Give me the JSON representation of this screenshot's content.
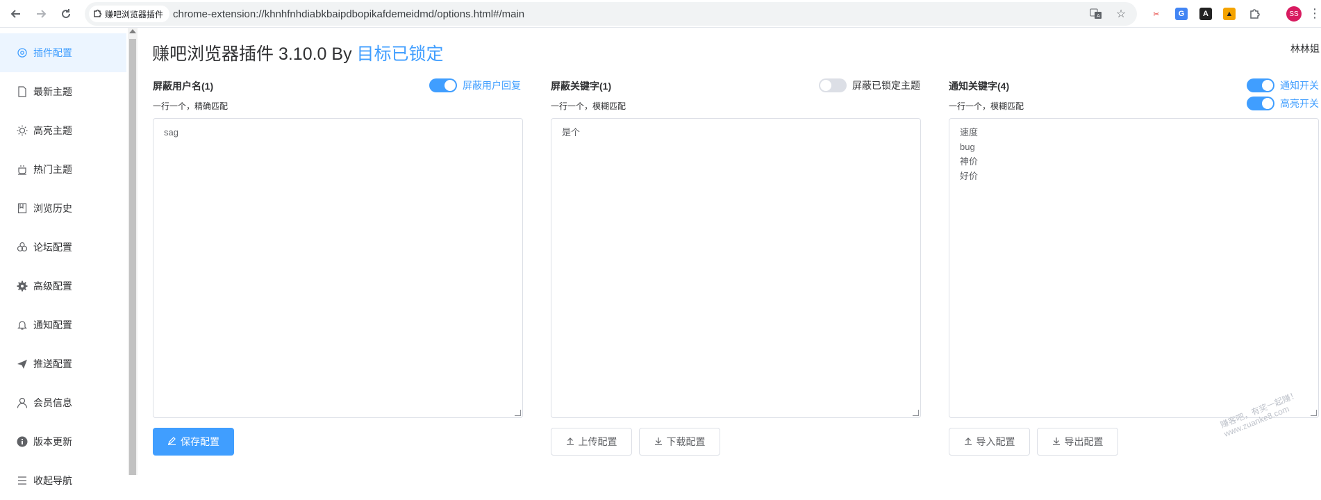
{
  "browser": {
    "extension_chip": "赚吧浏览器插件",
    "url": "chrome-extension://khnhfnhdiabkbaipdbopikafdemeidmd/options.html#/main",
    "avatar_initials": "SS"
  },
  "sidebar": {
    "items": [
      {
        "label": "插件配置",
        "icon": "settings-gear-icon",
        "active": true
      },
      {
        "label": "最新主题",
        "icon": "document-icon"
      },
      {
        "label": "高亮主题",
        "icon": "sun-icon"
      },
      {
        "label": "热门主题",
        "icon": "coffee-cup-icon"
      },
      {
        "label": "浏览历史",
        "icon": "notebook-icon"
      },
      {
        "label": "论坛配置",
        "icon": "cooperation-icon"
      },
      {
        "label": "高级配置",
        "icon": "gear-icon"
      },
      {
        "label": "通知配置",
        "icon": "bell-icon"
      },
      {
        "label": "推送配置",
        "icon": "send-icon"
      },
      {
        "label": "会员信息",
        "icon": "user-icon"
      },
      {
        "label": "版本更新",
        "icon": "info-icon"
      },
      {
        "label": "收起导航",
        "icon": "fold-icon"
      }
    ]
  },
  "header": {
    "title": "赚吧浏览器插件 3.10.0 By ",
    "title_link": "目标已锁定",
    "user": "林林姐"
  },
  "panels": {
    "block_users": {
      "title": "屏蔽用户名(1)",
      "hint": "一行一个，精确匹配",
      "switch_label": "屏蔽用户回复",
      "switch_on": true,
      "lines": [
        "sag"
      ]
    },
    "block_keywords": {
      "title": "屏蔽关键字(1)",
      "hint": "一行一个，模糊匹配",
      "switch_label": "屏蔽已锁定主题",
      "switch_on": false,
      "lines": [
        "是个"
      ]
    },
    "notify_keywords": {
      "title": "通知关键字(4)",
      "hint": "一行一个，模糊匹配",
      "switch1_label": "通知开关",
      "switch1_on": true,
      "switch2_label": "高亮开关",
      "switch2_on": true,
      "lines": [
        "速度",
        "bug",
        "神价",
        "好价"
      ]
    }
  },
  "buttons": {
    "save": "保存配置",
    "upload": "上传配置",
    "download": "下载配置",
    "import": "导入配置",
    "export": "导出配置"
  },
  "watermark": {
    "line1": "赚客吧，有奖一起赚！",
    "line2": "www.zuanke8.com"
  },
  "colors": {
    "accent": "#409eff",
    "active_bg": "#ecf5ff",
    "switch_off": "#dcdfe6"
  }
}
